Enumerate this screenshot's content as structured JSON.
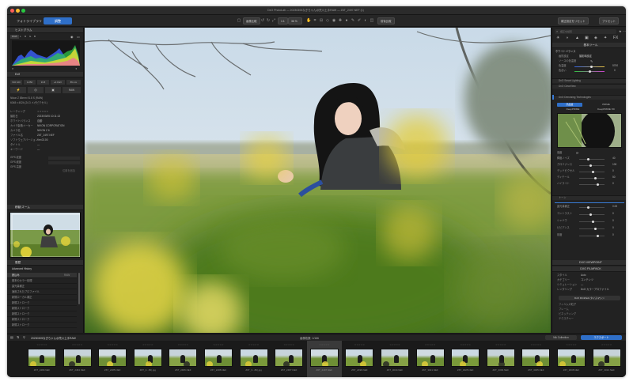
{
  "window": {
    "title": "DxO PhotoLab — 20230305なぎちゃん@荒川土手RAW — Z6T_2497.NEF (1)"
  },
  "toolbar": {
    "tab_library": "フォトライブラリ",
    "tab_customize": "調整",
    "compare_label": "画像比較",
    "zoom_fit": "1:1",
    "zoom_value": "36 %",
    "before_after": "前後比較",
    "reset_btn": "補正設定をリセット",
    "presets_btn": "プリセット"
  },
  "left": {
    "histogram_title": "ヒストグラム",
    "histogram_tabs": [
      "RGB",
      "L",
      "R",
      "G",
      "B"
    ],
    "exif_title": "Exif",
    "exif_chips": [
      "ISO 100",
      "1/250",
      "f/2.8",
      "+0.0 EV",
      "85 mm"
    ],
    "exif_mode": "RAW",
    "lens_line": "Nikon Z 85mm f/1.8 S (RAW)",
    "size_line": "6048 x 4024 (24.3 メガピクセル)",
    "meta_rows": [
      {
        "label": "レーティング",
        "value": "☆☆☆☆☆"
      },
      {
        "label": "撮影日",
        "value": "2023/03/05 10:11:13"
      },
      {
        "label": "ホワイトバランス",
        "value": "自動"
      },
      {
        "label": "カメラ製造メーカー",
        "value": "NIKON CORPORATION"
      },
      {
        "label": "カメラ名",
        "value": "NIKON Z 6"
      },
      {
        "label": "ファイル名",
        "value": "Z6T_2497.NEF"
      },
      {
        "label": "ソフトウェアバージョン",
        "value": "Ver.03.00"
      },
      {
        "label": "タイトル",
        "value": "—"
      },
      {
        "label": "キーワード",
        "value": "—"
      }
    ],
    "gps_rows": [
      "GPS 緯度",
      "GPS 経度",
      "GPS 高度"
    ],
    "gps_action": "位置を追加",
    "navigator_title": "移動/ズーム",
    "history_title": "履歴",
    "history_filter": "Advanced History",
    "history_items": [
      "読込み",
      "基本のカラー処理",
      "露光量補正",
      "適用されたプロファイル",
      "新規ローカル補正",
      "新規ストローク",
      "新規ストローク",
      "新規ストローク",
      "新規ストローク",
      "新規ストローク"
    ],
    "history_badge": "RAW"
  },
  "right": {
    "search_placeholder": "補正を検索",
    "panel_essential": "基本ツール",
    "wb_label": "ホワイトバランス",
    "wb_preset_label": "画質設定",
    "wb_preset_value": "撮影時設定",
    "wb_source_label": "ソースの色温度",
    "temp_label": "色温度",
    "temp_value": "5700",
    "tint_label": "色合い",
    "tint_value": "0",
    "tool_1": "DxO Smart Lighting",
    "tool_2": "DxO ClearView",
    "tool_3": "DxO Denoising Technologies",
    "denoise_modes": [
      "高品質",
      "PRIME",
      "DeepPRIME",
      "DeepPRIME XD"
    ],
    "denoise_opts": [
      "強度",
      "輝度ノイズ",
      "クロミナンス",
      "デッドピクセル"
    ],
    "slider_rows": [
      {
        "label": "輝度ノイズ",
        "value": "40"
      },
      {
        "label": "クロミナンス",
        "value": "100"
      },
      {
        "label": "デッドピクセル",
        "value": "0"
      },
      {
        "label": "ディテール",
        "value": "50"
      },
      {
        "label": "ハイライト",
        "value": "0"
      }
    ],
    "section_tone": "トーン",
    "color_rows": [
      {
        "label": "露光量補正",
        "value": "0.00"
      },
      {
        "label": "コントラスト",
        "value": "0"
      },
      {
        "label": "シャドウ",
        "value": "0"
      },
      {
        "label": "ビビアンス",
        "value": "0"
      },
      {
        "label": "彩度",
        "value": "0"
      }
    ],
    "section_viewpoint": "DXO VIEWPOINT",
    "section_filmpack": "DXO FILMPACK",
    "film_rows": [
      {
        "label": "スタイル",
        "value": "Auto"
      },
      {
        "label": "カテゴリー",
        "value": "コンテンツ"
      },
      {
        "label": "シミュレーション",
        "value": "—"
      },
      {
        "label": "レンダリング",
        "value": "DxO カラープロファイル"
      }
    ],
    "film_btn": "DxO FilmPack タイムマシン",
    "film_extra": [
      "フィルムの粒子",
      "フレーム",
      "ビネッティング",
      "テクスチャー"
    ]
  },
  "filmstrip": {
    "folder": "20230305なぎちゃん@荒川土手RAW",
    "counter": "画像枚数: 1/166",
    "nik_btn": "Nik Collection",
    "export_btn": "エクスポート",
    "thumbs": [
      {
        "name": "Z6T_2483.NEF",
        "stars": "☆☆☆☆☆"
      },
      {
        "name": "Z6T_2484.NEF",
        "stars": "☆☆☆☆☆"
      },
      {
        "name": "Z6T_2485.NEF",
        "stars": "☆☆☆☆☆"
      },
      {
        "name": "Z6T_3...86).jpg",
        "stars": "☆☆☆☆☆"
      },
      {
        "name": "Z6T_2486.NEF",
        "stars": "☆☆☆☆☆"
      },
      {
        "name": "Z6T_2488.NEF",
        "stars": "☆☆☆☆☆"
      },
      {
        "name": "Z6T_3...86).jpg",
        "stars": "☆☆☆☆☆"
      },
      {
        "name": "Z6T_2487.NEF",
        "stars": "☆☆☆☆☆"
      },
      {
        "name": "Z6T_2497.NEF",
        "stars": "☆☆☆☆☆"
      },
      {
        "name": "Z6T_2498.NEF",
        "stars": "☆☆☆☆☆"
      },
      {
        "name": "Z6T_3030.NEF",
        "stars": "☆☆☆☆☆"
      },
      {
        "name": "Z6T_3021.NEF",
        "stars": "☆☆☆☆☆"
      },
      {
        "name": "Z6T_3025.NEF",
        "stars": "☆☆☆☆☆"
      },
      {
        "name": "Z6T_3003.NEF",
        "stars": "☆☆☆☆☆"
      },
      {
        "name": "Z6T_3005.NEF",
        "stars": "☆☆☆☆☆"
      },
      {
        "name": "Z6T_3008.NEF",
        "stars": "☆☆☆☆☆"
      },
      {
        "name": "Z6T_3010.NEF",
        "stars": "☆☆☆☆☆"
      }
    ]
  },
  "colors": {
    "accent": "#3a7dd8",
    "panel": "#222222",
    "header": "#2e2e2e"
  }
}
